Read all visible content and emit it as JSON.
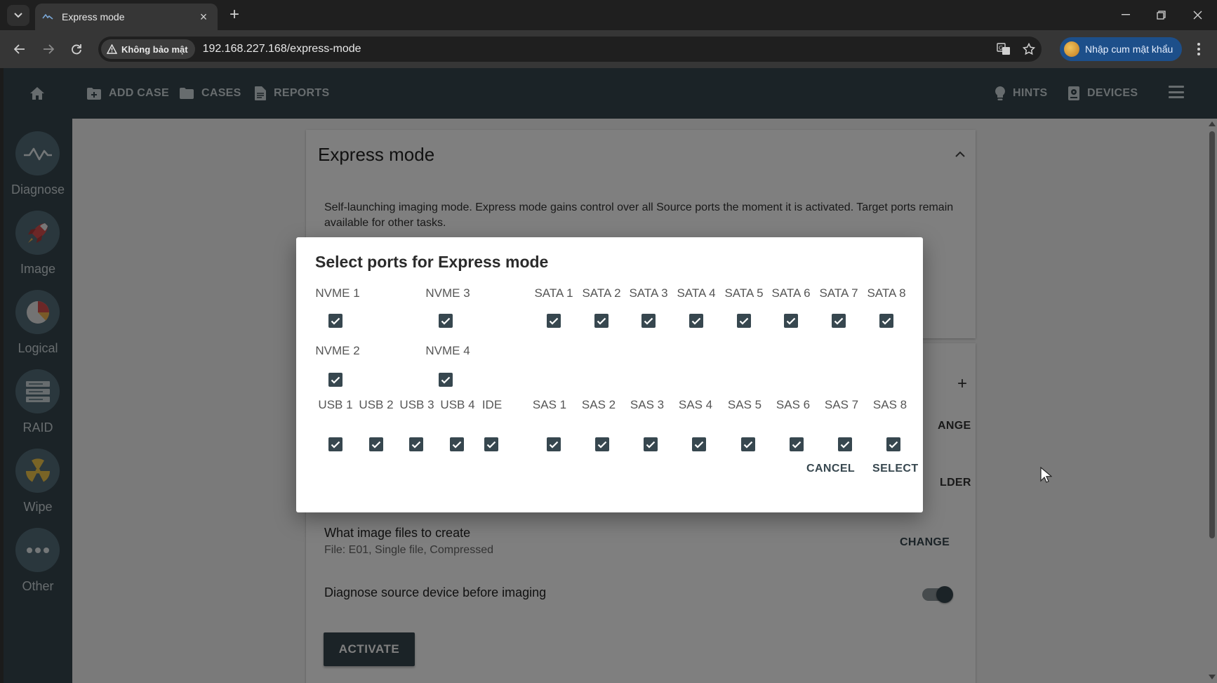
{
  "browser": {
    "tab_title": "Express mode",
    "security_label": "Không bảo mật",
    "url": "192.168.227.168/express-mode",
    "profile_label": "Nhập cum mật khẩu"
  },
  "topnav": {
    "add_case": "ADD CASE",
    "cases": "CASES",
    "reports": "REPORTS",
    "hints": "HINTS",
    "devices": "DEVICES"
  },
  "sidebar": {
    "items": [
      {
        "label": "Diagnose",
        "icon": "diagnose-wave-icon"
      },
      {
        "label": "Image",
        "icon": "rocket-icon"
      },
      {
        "label": "Logical",
        "icon": "pie-chart-icon"
      },
      {
        "label": "RAID",
        "icon": "raid-stack-icon"
      },
      {
        "label": "Wipe",
        "icon": "radiation-icon"
      },
      {
        "label": "Other",
        "icon": "more-dots-icon"
      }
    ]
  },
  "page": {
    "title": "Express mode",
    "description": "Self-launching imaging mode. Express mode gains control over all Source ports the moment it is activated. Target ports remain available for other tasks.",
    "frag_change": "ANGE",
    "frag_folder": "LDER",
    "image_files_title": "What image files to create",
    "image_files_sub": "File: E01, Single file, Compressed",
    "change_label": "CHANGE",
    "diagnose_label": "Diagnose source device before imaging",
    "diagnose_enabled": true,
    "activate_label": "ACTIVATE"
  },
  "dialog": {
    "title": "Select ports for Express mode",
    "nvme_ports": [
      {
        "label": "NVME 1",
        "checked": true
      },
      {
        "label": "NVME 3",
        "checked": true
      },
      {
        "label": "NVME 2",
        "checked": true
      },
      {
        "label": "NVME 4",
        "checked": true
      }
    ],
    "sata_ports": [
      {
        "label": "SATA 1",
        "checked": true
      },
      {
        "label": "SATA 2",
        "checked": true
      },
      {
        "label": "SATA 3",
        "checked": true
      },
      {
        "label": "SATA 4",
        "checked": true
      },
      {
        "label": "SATA 5",
        "checked": true
      },
      {
        "label": "SATA 6",
        "checked": true
      },
      {
        "label": "SATA 7",
        "checked": true
      },
      {
        "label": "SATA 8",
        "checked": true
      }
    ],
    "usb_ports": [
      {
        "label": "USB 1",
        "checked": true
      },
      {
        "label": "USB 2",
        "checked": true
      },
      {
        "label": "USB 3",
        "checked": true
      },
      {
        "label": "USB 4",
        "checked": true
      },
      {
        "label": "IDE",
        "checked": true
      }
    ],
    "sas_ports": [
      {
        "label": "SAS 1",
        "checked": true
      },
      {
        "label": "SAS 2",
        "checked": true
      },
      {
        "label": "SAS 3",
        "checked": true
      },
      {
        "label": "SAS 4",
        "checked": true
      },
      {
        "label": "SAS 5",
        "checked": true
      },
      {
        "label": "SAS 6",
        "checked": true
      },
      {
        "label": "SAS 7",
        "checked": true
      },
      {
        "label": "SAS 8",
        "checked": true
      }
    ],
    "cancel_label": "CANCEL",
    "select_label": "SELECT"
  },
  "colors": {
    "app_bar": "#37474f",
    "accent": "#37474f",
    "browser_profile": "#1d4f8a"
  }
}
